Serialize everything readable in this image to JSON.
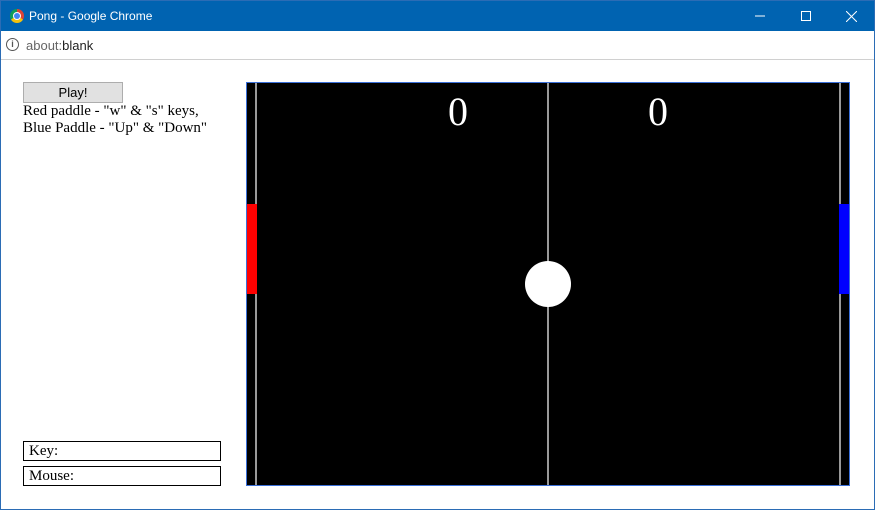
{
  "window": {
    "title": "Pong - Google Chrome"
  },
  "address_bar": {
    "scheme": "about:",
    "rest": "blank"
  },
  "controls": {
    "play_label": "Play!",
    "instructions_line1": "Red paddle - \"w\" & \"s\" keys,",
    "instructions_line2": "Blue Paddle - \"Up\" & \"Down\""
  },
  "readouts": {
    "key_label": "Key:",
    "mouse_label": "Mouse:"
  },
  "game": {
    "score_red": "0",
    "score_blue": "0",
    "colors": {
      "background": "#000000",
      "red_paddle": "#ff0000",
      "blue_paddle": "#0000ff",
      "ball": "#ffffff",
      "lines": "#999999"
    }
  }
}
